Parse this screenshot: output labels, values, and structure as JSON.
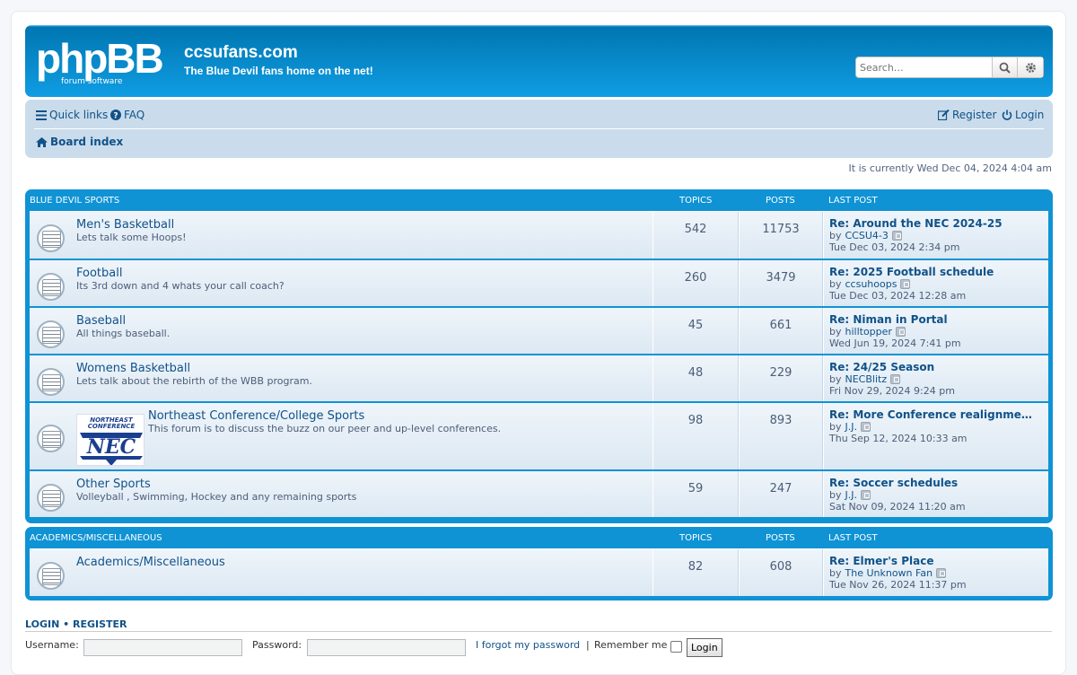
{
  "header": {
    "logo_text": "phpBB",
    "logo_sub": "forum  software",
    "site_title": "ccsufans.com",
    "site_desc": "The Blue Devil fans home on the net!",
    "search_placeholder": "Search…"
  },
  "nav": {
    "quick_links": "Quick links",
    "faq": "FAQ",
    "register": "Register",
    "login": "Login",
    "board_index": "Board index"
  },
  "current_time": "It is currently Wed Dec 04, 2024 4:04 am",
  "categories": [
    {
      "name": "BLUE DEVIL SPORTS",
      "col_topics": "TOPICS",
      "col_posts": "POSTS",
      "col_last": "LAST POST",
      "forums": [
        {
          "title": "Men's Basketball",
          "desc": "Lets talk some Hoops!",
          "topics": "542",
          "posts": "11753",
          "last_title": "Re: Around the NEC 2024-25",
          "by": "by",
          "last_user": "CCSU4-3",
          "last_date": "Tue Dec 03, 2024 2:34 pm"
        },
        {
          "title": "Football",
          "desc": "Its 3rd down and 4 whats your call coach?",
          "topics": "260",
          "posts": "3479",
          "last_title": "Re: 2025 Football schedule",
          "by": "by",
          "last_user": "ccsuhoops",
          "last_date": "Tue Dec 03, 2024 12:28 am"
        },
        {
          "title": "Baseball",
          "desc": "All things baseball.",
          "topics": "45",
          "posts": "661",
          "last_title": "Re: Niman in Portal",
          "by": "by",
          "last_user": "hilltopper",
          "last_date": "Wed Jun 19, 2024 7:41 pm"
        },
        {
          "title": "Womens Basketball",
          "desc": "Lets talk about the rebirth of the WBB program.",
          "topics": "48",
          "posts": "229",
          "last_title": "Re: 24/25 Season",
          "by": "by",
          "last_user": "NECBlitz",
          "last_date": "Fri Nov 29, 2024 9:24 pm"
        },
        {
          "title": "Northeast Conference/College Sports",
          "desc": "This forum is to discuss the buzz on our peer and up-level conferences.",
          "topics": "98",
          "posts": "893",
          "last_title": "Re: More Conference realignme…",
          "by": "by",
          "last_user": "J.J.",
          "last_date": "Thu Sep 12, 2024 10:33 am",
          "image_text_top": "NORTHEAST",
          "image_text_mid": "CONFERENCE",
          "image_text_big": "NEC"
        },
        {
          "title": "Other Sports",
          "desc": "Volleyball , Swimming, Hockey and any remaining sports",
          "topics": "59",
          "posts": "247",
          "last_title": "Re: Soccer schedules",
          "by": "by",
          "last_user": "J.J.",
          "last_date": "Sat Nov 09, 2024 11:20 am"
        }
      ]
    },
    {
      "name": "ACADEMICS/MISCELLANEOUS",
      "col_topics": "TOPICS",
      "col_posts": "POSTS",
      "col_last": "LAST POST",
      "forums": [
        {
          "title": "Academics/Miscellaneous",
          "desc": "",
          "topics": "82",
          "posts": "608",
          "last_title": "Re: Elmer's Place",
          "by": "by",
          "last_user": "The Unknown Fan",
          "last_date": "Tue Nov 26, 2024 11:37 pm"
        }
      ]
    }
  ],
  "login": {
    "heading_login": "LOGIN",
    "heading_sep": "•",
    "heading_register": "REGISTER",
    "username_label": "Username:",
    "password_label": "Password:",
    "forgot": "I forgot my password",
    "divider": "|",
    "remember": "Remember me",
    "button": "Login"
  },
  "colors": {
    "header_blue": "#12a3eb",
    "link_blue": "#105289",
    "nav_bg": "#cadceb",
    "forum_block": "#0f93d5"
  }
}
